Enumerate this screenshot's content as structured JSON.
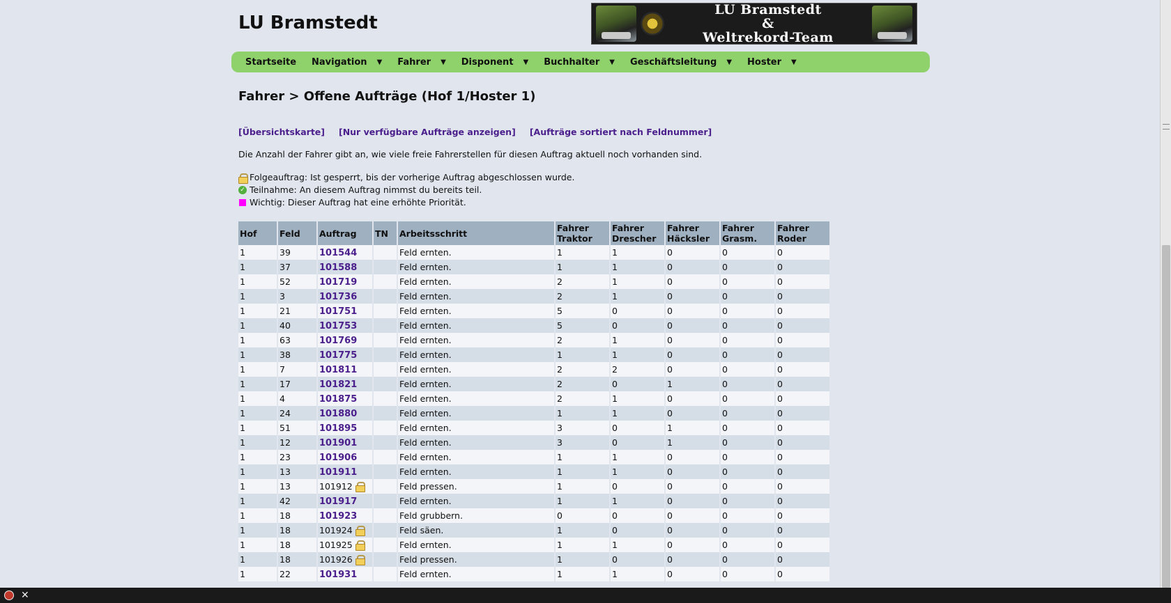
{
  "site": {
    "title": "LU Bramstedt"
  },
  "banner": {
    "line1": "LU Bramstedt",
    "line2": "&",
    "line3": "Weltrekord-Team"
  },
  "nav": [
    {
      "label": "Startseite",
      "has_menu": false
    },
    {
      "label": "Navigation",
      "has_menu": true
    },
    {
      "label": "Fahrer",
      "has_menu": true
    },
    {
      "label": "Disponent",
      "has_menu": true
    },
    {
      "label": "Buchhalter",
      "has_menu": true
    },
    {
      "label": "Geschäftsleitung",
      "has_menu": true
    },
    {
      "label": "Hoster",
      "has_menu": true
    }
  ],
  "heading": "Fahrer > Offene Aufträge (Hof 1/Hoster 1)",
  "links": [
    "[Übersichtskarte]",
    "[Nur verfügbare Aufträge anzeigen]",
    "[Aufträge sortiert nach Feldnummer]"
  ],
  "info_text": "Die Anzahl der Fahrer gibt an, wie viele freie Fahrerstellen für diesen Auftrag aktuell noch vorhanden sind.",
  "legend": {
    "locked": "Folgeauftrag: Ist gesperrt, bis der vorherige Auftrag abgeschlossen wurde.",
    "participating": "Teilnahme: An diesem Auftrag nimmst du bereits teil.",
    "important": "Wichtig: Dieser Auftrag hat eine erhöhte Priorität.",
    "important_color": "#ff00ff"
  },
  "table": {
    "headers": {
      "hof": "Hof",
      "feld": "Feld",
      "auftrag": "Auftrag",
      "tn": "TN",
      "arbeit": "Arbeitsschritt",
      "traktor_1": "Fahrer",
      "traktor_2": "Traktor",
      "drescher_1": "Fahrer",
      "drescher_2": "Drescher",
      "haecksler_1": "Fahrer",
      "haecksler_2": "Häcksler",
      "grasm_1": "Fahrer",
      "grasm_2": "Grasm.",
      "roder_1": "Fahrer",
      "roder_2": "Roder"
    },
    "rows": [
      {
        "hof": "1",
        "feld": "39",
        "auftrag": "101544",
        "locked": false,
        "tn": "",
        "arbeit": "Feld ernten.",
        "traktor": "1",
        "drescher": "1",
        "haecksler": "0",
        "grasm": "0",
        "roder": "0"
      },
      {
        "hof": "1",
        "feld": "37",
        "auftrag": "101588",
        "locked": false,
        "tn": "",
        "arbeit": "Feld ernten.",
        "traktor": "1",
        "drescher": "1",
        "haecksler": "0",
        "grasm": "0",
        "roder": "0"
      },
      {
        "hof": "1",
        "feld": "52",
        "auftrag": "101719",
        "locked": false,
        "tn": "",
        "arbeit": "Feld ernten.",
        "traktor": "2",
        "drescher": "1",
        "haecksler": "0",
        "grasm": "0",
        "roder": "0"
      },
      {
        "hof": "1",
        "feld": "3",
        "auftrag": "101736",
        "locked": false,
        "tn": "",
        "arbeit": "Feld ernten.",
        "traktor": "2",
        "drescher": "1",
        "haecksler": "0",
        "grasm": "0",
        "roder": "0"
      },
      {
        "hof": "1",
        "feld": "21",
        "auftrag": "101751",
        "locked": false,
        "tn": "",
        "arbeit": "Feld ernten.",
        "traktor": "5",
        "drescher": "0",
        "haecksler": "0",
        "grasm": "0",
        "roder": "0"
      },
      {
        "hof": "1",
        "feld": "40",
        "auftrag": "101753",
        "locked": false,
        "tn": "",
        "arbeit": "Feld ernten.",
        "traktor": "5",
        "drescher": "0",
        "haecksler": "0",
        "grasm": "0",
        "roder": "0"
      },
      {
        "hof": "1",
        "feld": "63",
        "auftrag": "101769",
        "locked": false,
        "tn": "",
        "arbeit": "Feld ernten.",
        "traktor": "2",
        "drescher": "1",
        "haecksler": "0",
        "grasm": "0",
        "roder": "0"
      },
      {
        "hof": "1",
        "feld": "38",
        "auftrag": "101775",
        "locked": false,
        "tn": "",
        "arbeit": "Feld ernten.",
        "traktor": "1",
        "drescher": "1",
        "haecksler": "0",
        "grasm": "0",
        "roder": "0"
      },
      {
        "hof": "1",
        "feld": "7",
        "auftrag": "101811",
        "locked": false,
        "tn": "",
        "arbeit": "Feld ernten.",
        "traktor": "2",
        "drescher": "2",
        "haecksler": "0",
        "grasm": "0",
        "roder": "0"
      },
      {
        "hof": "1",
        "feld": "17",
        "auftrag": "101821",
        "locked": false,
        "tn": "",
        "arbeit": "Feld ernten.",
        "traktor": "2",
        "drescher": "0",
        "haecksler": "1",
        "grasm": "0",
        "roder": "0"
      },
      {
        "hof": "1",
        "feld": "4",
        "auftrag": "101875",
        "locked": false,
        "tn": "",
        "arbeit": "Feld ernten.",
        "traktor": "2",
        "drescher": "1",
        "haecksler": "0",
        "grasm": "0",
        "roder": "0"
      },
      {
        "hof": "1",
        "feld": "24",
        "auftrag": "101880",
        "locked": false,
        "tn": "",
        "arbeit": "Feld ernten.",
        "traktor": "1",
        "drescher": "1",
        "haecksler": "0",
        "grasm": "0",
        "roder": "0"
      },
      {
        "hof": "1",
        "feld": "51",
        "auftrag": "101895",
        "locked": false,
        "tn": "",
        "arbeit": "Feld ernten.",
        "traktor": "3",
        "drescher": "0",
        "haecksler": "1",
        "grasm": "0",
        "roder": "0"
      },
      {
        "hof": "1",
        "feld": "12",
        "auftrag": "101901",
        "locked": false,
        "tn": "",
        "arbeit": "Feld ernten.",
        "traktor": "3",
        "drescher": "0",
        "haecksler": "1",
        "grasm": "0",
        "roder": "0"
      },
      {
        "hof": "1",
        "feld": "23",
        "auftrag": "101906",
        "locked": false,
        "tn": "",
        "arbeit": "Feld ernten.",
        "traktor": "1",
        "drescher": "1",
        "haecksler": "0",
        "grasm": "0",
        "roder": "0"
      },
      {
        "hof": "1",
        "feld": "13",
        "auftrag": "101911",
        "locked": false,
        "tn": "",
        "arbeit": "Feld ernten.",
        "traktor": "1",
        "drescher": "1",
        "haecksler": "0",
        "grasm": "0",
        "roder": "0"
      },
      {
        "hof": "1",
        "feld": "13",
        "auftrag": "101912",
        "locked": true,
        "tn": "",
        "arbeit": "Feld pressen.",
        "traktor": "1",
        "drescher": "0",
        "haecksler": "0",
        "grasm": "0",
        "roder": "0"
      },
      {
        "hof": "1",
        "feld": "42",
        "auftrag": "101917",
        "locked": false,
        "tn": "",
        "arbeit": "Feld ernten.",
        "traktor": "1",
        "drescher": "1",
        "haecksler": "0",
        "grasm": "0",
        "roder": "0"
      },
      {
        "hof": "1",
        "feld": "18",
        "auftrag": "101923",
        "locked": false,
        "tn": "",
        "arbeit": "Feld grubbern.",
        "traktor": "0",
        "drescher": "0",
        "haecksler": "0",
        "grasm": "0",
        "roder": "0"
      },
      {
        "hof": "1",
        "feld": "18",
        "auftrag": "101924",
        "locked": true,
        "tn": "",
        "arbeit": "Feld säen.",
        "traktor": "1",
        "drescher": "0",
        "haecksler": "0",
        "grasm": "0",
        "roder": "0"
      },
      {
        "hof": "1",
        "feld": "18",
        "auftrag": "101925",
        "locked": true,
        "tn": "",
        "arbeit": "Feld ernten.",
        "traktor": "1",
        "drescher": "1",
        "haecksler": "0",
        "grasm": "0",
        "roder": "0"
      },
      {
        "hof": "1",
        "feld": "18",
        "auftrag": "101926",
        "locked": true,
        "tn": "",
        "arbeit": "Feld pressen.",
        "traktor": "1",
        "drescher": "0",
        "haecksler": "0",
        "grasm": "0",
        "roder": "0"
      },
      {
        "hof": "1",
        "feld": "22",
        "auftrag": "101931",
        "locked": false,
        "tn": "",
        "arbeit": "Feld ernten.",
        "traktor": "1",
        "drescher": "1",
        "haecksler": "0",
        "grasm": "0",
        "roder": "0"
      }
    ]
  },
  "colors": {
    "nav_bg": "#8fd16a",
    "link": "#4b1f8c",
    "table_header": "#9fb0c1"
  },
  "icons": {
    "locked": "lock-icon",
    "participating": "checkmark-icon",
    "important": "pink-square-icon"
  }
}
